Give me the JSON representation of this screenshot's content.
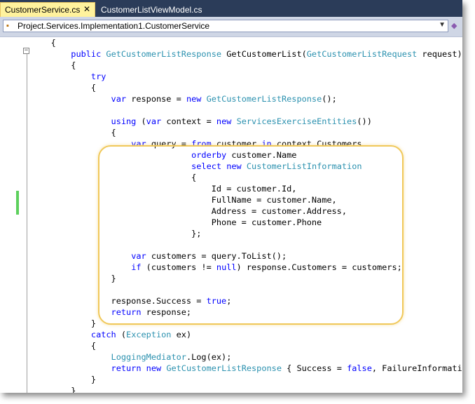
{
  "tabs": [
    {
      "label": "CustomerService.cs",
      "active": true,
      "close_glyph": "✕"
    },
    {
      "label": "CustomerListViewModel.cs",
      "active": false
    }
  ],
  "navbar": {
    "type_selector": "Project.Services.Implementation1.CustomerService",
    "dropdown_icon": "chevron-down-icon"
  },
  "colors": {
    "keyword": "#0000ff",
    "type": "#2b91af",
    "active_tab": "#fff29d",
    "tab_strip": "#2b3c59",
    "highlight_border": "#f0c85a",
    "change_marker": "#5cd05c"
  },
  "code_lines": [
    [
      {
        "t": "p",
        "v": "    {"
      }
    ],
    [
      {
        "t": "p",
        "v": "        "
      },
      {
        "t": "k",
        "v": "public"
      },
      {
        "t": "p",
        "v": " "
      },
      {
        "t": "t",
        "v": "GetCustomerListResponse"
      },
      {
        "t": "p",
        "v": " GetCustomerList("
      },
      {
        "t": "t",
        "v": "GetCustomerListRequest"
      },
      {
        "t": "p",
        "v": " request)"
      }
    ],
    [
      {
        "t": "p",
        "v": "        {"
      }
    ],
    [
      {
        "t": "p",
        "v": "            "
      },
      {
        "t": "k",
        "v": "try"
      }
    ],
    [
      {
        "t": "p",
        "v": "            {"
      }
    ],
    [
      {
        "t": "p",
        "v": "                "
      },
      {
        "t": "k",
        "v": "var"
      },
      {
        "t": "p",
        "v": " response = "
      },
      {
        "t": "k",
        "v": "new"
      },
      {
        "t": "p",
        "v": " "
      },
      {
        "t": "t",
        "v": "GetCustomerListResponse"
      },
      {
        "t": "p",
        "v": "();"
      }
    ],
    [
      {
        "t": "p",
        "v": ""
      }
    ],
    [
      {
        "t": "p",
        "v": "                "
      },
      {
        "t": "k",
        "v": "using"
      },
      {
        "t": "p",
        "v": " ("
      },
      {
        "t": "k",
        "v": "var"
      },
      {
        "t": "p",
        "v": " context = "
      },
      {
        "t": "k",
        "v": "new"
      },
      {
        "t": "p",
        "v": " "
      },
      {
        "t": "t",
        "v": "ServicesExerciseEntities"
      },
      {
        "t": "p",
        "v": "())"
      }
    ],
    [
      {
        "t": "p",
        "v": "                {"
      }
    ],
    [
      {
        "t": "p",
        "v": "                    "
      },
      {
        "t": "k",
        "v": "var"
      },
      {
        "t": "p",
        "v": " query = "
      },
      {
        "t": "k",
        "v": "from"
      },
      {
        "t": "p",
        "v": " customer "
      },
      {
        "t": "k",
        "v": "in"
      },
      {
        "t": "p",
        "v": " context.Customers"
      }
    ],
    [
      {
        "t": "p",
        "v": "                                "
      },
      {
        "t": "k",
        "v": "orderby"
      },
      {
        "t": "p",
        "v": " customer.Name"
      }
    ],
    [
      {
        "t": "p",
        "v": "                                "
      },
      {
        "t": "k",
        "v": "select"
      },
      {
        "t": "p",
        "v": " "
      },
      {
        "t": "k",
        "v": "new"
      },
      {
        "t": "p",
        "v": " "
      },
      {
        "t": "t",
        "v": "CustomerListInformation"
      }
    ],
    [
      {
        "t": "p",
        "v": "                                {"
      }
    ],
    [
      {
        "t": "p",
        "v": "                                    Id = customer.Id,"
      }
    ],
    [
      {
        "t": "p",
        "v": "                                    FullName = customer.Name,"
      }
    ],
    [
      {
        "t": "p",
        "v": "                                    Address = customer.Address,"
      }
    ],
    [
      {
        "t": "p",
        "v": "                                    Phone = customer.Phone"
      }
    ],
    [
      {
        "t": "p",
        "v": "                                };"
      }
    ],
    [
      {
        "t": "p",
        "v": ""
      }
    ],
    [
      {
        "t": "p",
        "v": "                    "
      },
      {
        "t": "k",
        "v": "var"
      },
      {
        "t": "p",
        "v": " customers = query.ToList();"
      }
    ],
    [
      {
        "t": "p",
        "v": "                    "
      },
      {
        "t": "k",
        "v": "if"
      },
      {
        "t": "p",
        "v": " (customers != "
      },
      {
        "t": "k",
        "v": "null"
      },
      {
        "t": "p",
        "v": ") response.Customers = customers;"
      }
    ],
    [
      {
        "t": "p",
        "v": "                }"
      }
    ],
    [
      {
        "t": "p",
        "v": ""
      }
    ],
    [
      {
        "t": "p",
        "v": "                response.Success = "
      },
      {
        "t": "k",
        "v": "true"
      },
      {
        "t": "p",
        "v": ";"
      }
    ],
    [
      {
        "t": "p",
        "v": "                "
      },
      {
        "t": "k",
        "v": "return"
      },
      {
        "t": "p",
        "v": " response;"
      }
    ],
    [
      {
        "t": "p",
        "v": "            }"
      }
    ],
    [
      {
        "t": "p",
        "v": "            "
      },
      {
        "t": "k",
        "v": "catch"
      },
      {
        "t": "p",
        "v": " ("
      },
      {
        "t": "t",
        "v": "Exception"
      },
      {
        "t": "p",
        "v": " ex)"
      }
    ],
    [
      {
        "t": "p",
        "v": "            {"
      }
    ],
    [
      {
        "t": "p",
        "v": "                "
      },
      {
        "t": "t",
        "v": "LoggingMediator"
      },
      {
        "t": "p",
        "v": ".Log(ex);"
      }
    ],
    [
      {
        "t": "p",
        "v": "                "
      },
      {
        "t": "k",
        "v": "return"
      },
      {
        "t": "p",
        "v": " "
      },
      {
        "t": "k",
        "v": "new"
      },
      {
        "t": "p",
        "v": " "
      },
      {
        "t": "t",
        "v": "GetCustomerListResponse"
      },
      {
        "t": "p",
        "v": " { Success = "
      },
      {
        "t": "k",
        "v": "false"
      },
      {
        "t": "p",
        "v": ", FailureInformation"
      }
    ],
    [
      {
        "t": "p",
        "v": "            }"
      }
    ],
    [
      {
        "t": "p",
        "v": "        }"
      }
    ]
  ]
}
